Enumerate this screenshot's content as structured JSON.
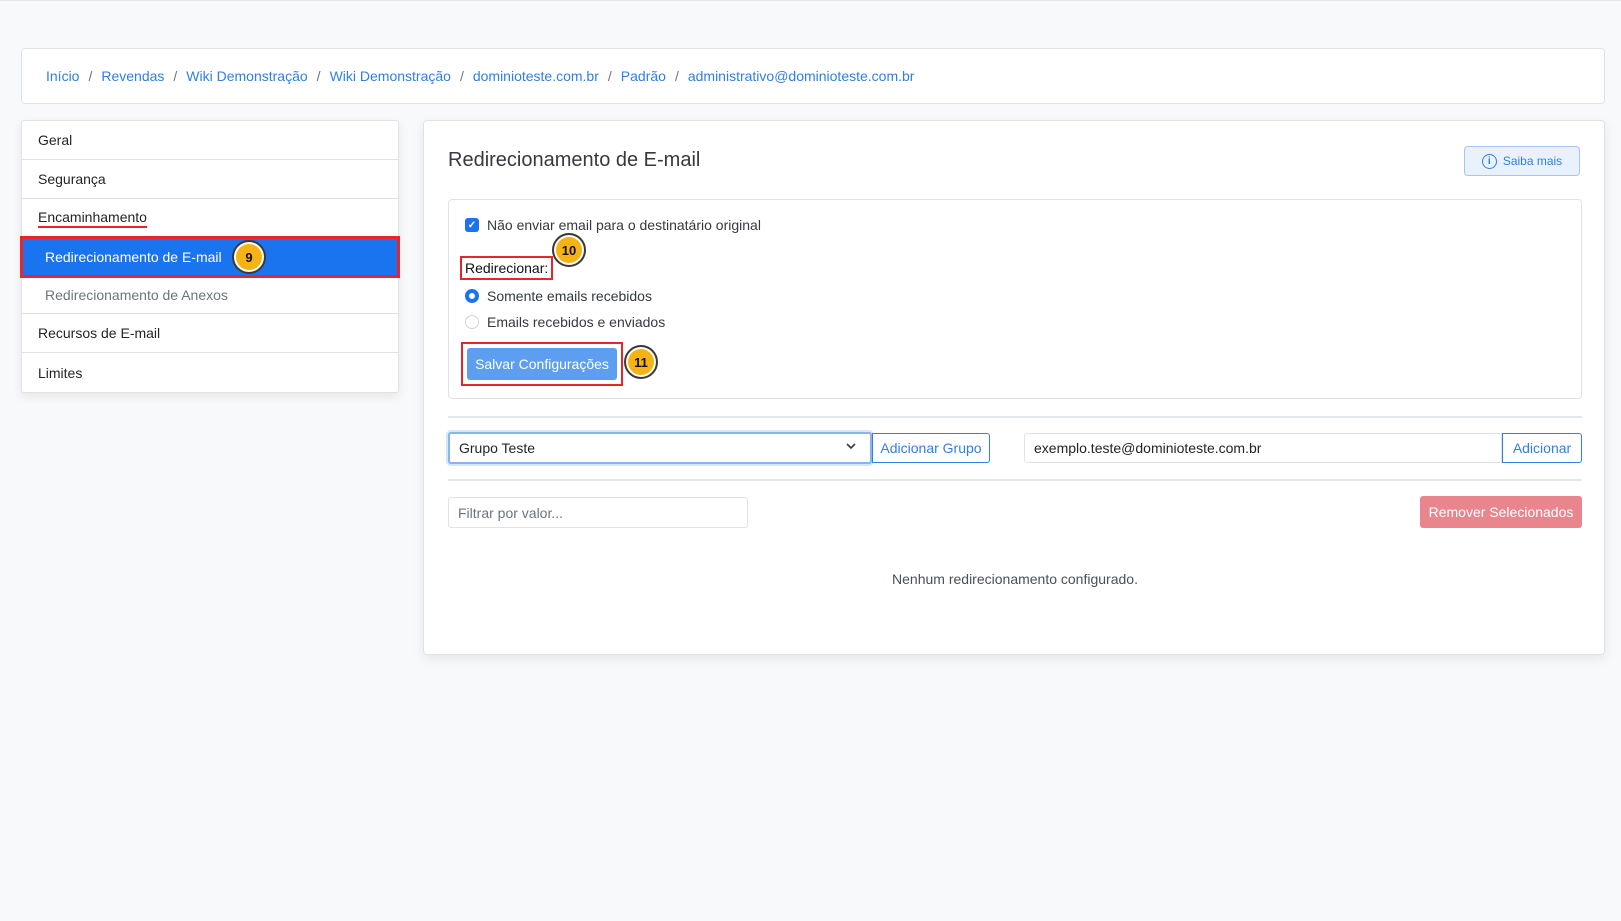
{
  "breadcrumb": [
    "Início",
    "Revendas",
    "Wiki Demonstração",
    "Wiki Demonstração",
    "dominioteste.com.br",
    "Padrão",
    "administrativo@dominioteste.com.br"
  ],
  "sidebar": {
    "items": {
      "geral": "Geral",
      "seguranca": "Segurança",
      "encaminhamento": "Encaminhamento",
      "redir_email": "Redirecionamento de E-mail",
      "redir_anexos": "Redirecionamento de Anexos",
      "recursos": "Recursos de E-mail",
      "limites": "Limites"
    },
    "active_item": "redir_email"
  },
  "badges": {
    "step9": "9",
    "step10": "10",
    "step11": "11"
  },
  "panel": {
    "title": "Redirecionamento de E-mail",
    "saiba_mais": "Saiba mais",
    "info_icon": "i"
  },
  "config": {
    "no_send_label": "Não enviar email para o destinatário original",
    "no_send_checked": true,
    "redirect_label": "Redirecionar:",
    "option_received": "Somente emails recebidos",
    "option_both": "Emails recebidos e enviados",
    "selected_option": "received",
    "save_button": "Salvar Configurações"
  },
  "group": {
    "selected": "Grupo Teste",
    "add_group_button": "Adicionar Grupo"
  },
  "email_add": {
    "value": "exemplo.teste@dominioteste.com.br",
    "add_button": "Adicionar"
  },
  "filter": {
    "placeholder": "Filtrar por valor..."
  },
  "remove_button": "Remover Selecionados",
  "empty_message": "Nenhum redirecionamento configurado.",
  "colors": {
    "primary": "#1b74ef",
    "link": "#2f7fe6",
    "highlight": "#e5262d",
    "badge": "#f6b316",
    "danger_light": "#e8858d"
  }
}
